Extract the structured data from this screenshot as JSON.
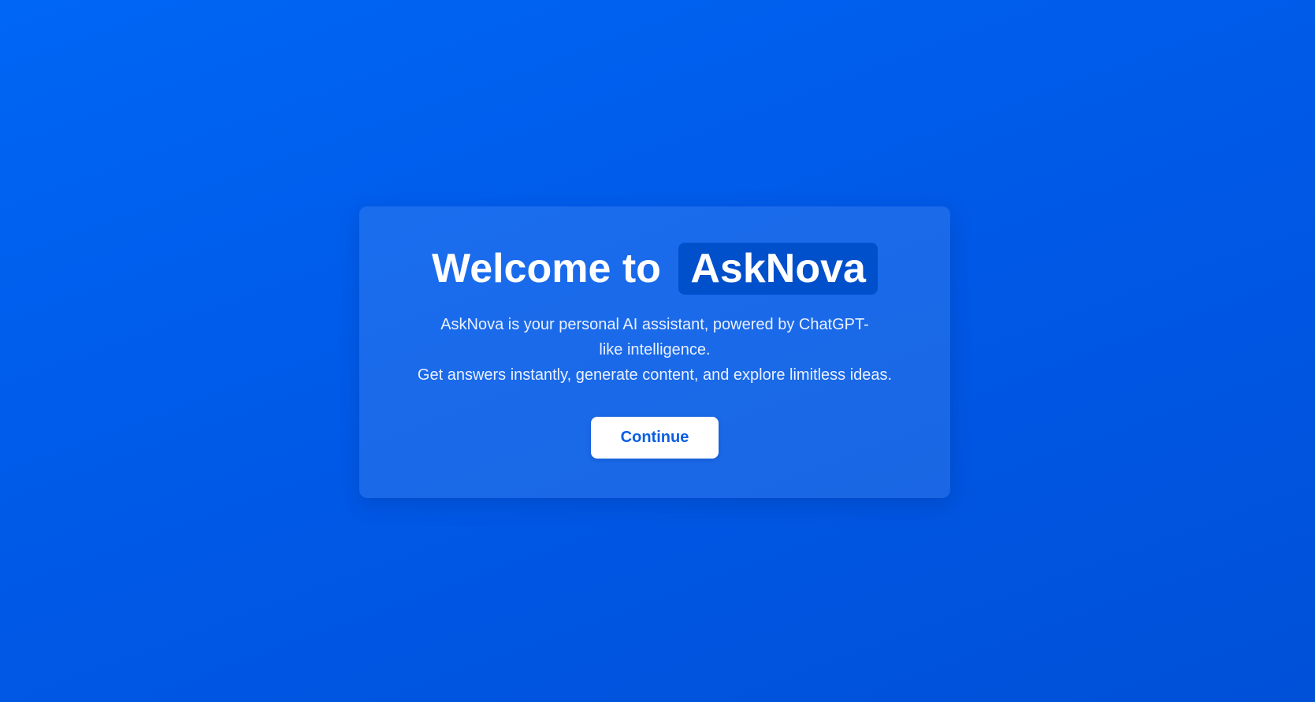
{
  "welcome": {
    "title_prefix": "Welcome to",
    "brand": "AskNova",
    "description_line1": "AskNova is your personal AI assistant, powered by ChatGPT-like intelligence.",
    "description_line2": "Get answers instantly, generate content, and explore limitless ideas.",
    "continue_label": "Continue"
  },
  "colors": {
    "background": "#0060f0",
    "brand_badge": "#0050cc",
    "button_text": "#0b5ee0",
    "button_background": "#ffffff"
  }
}
